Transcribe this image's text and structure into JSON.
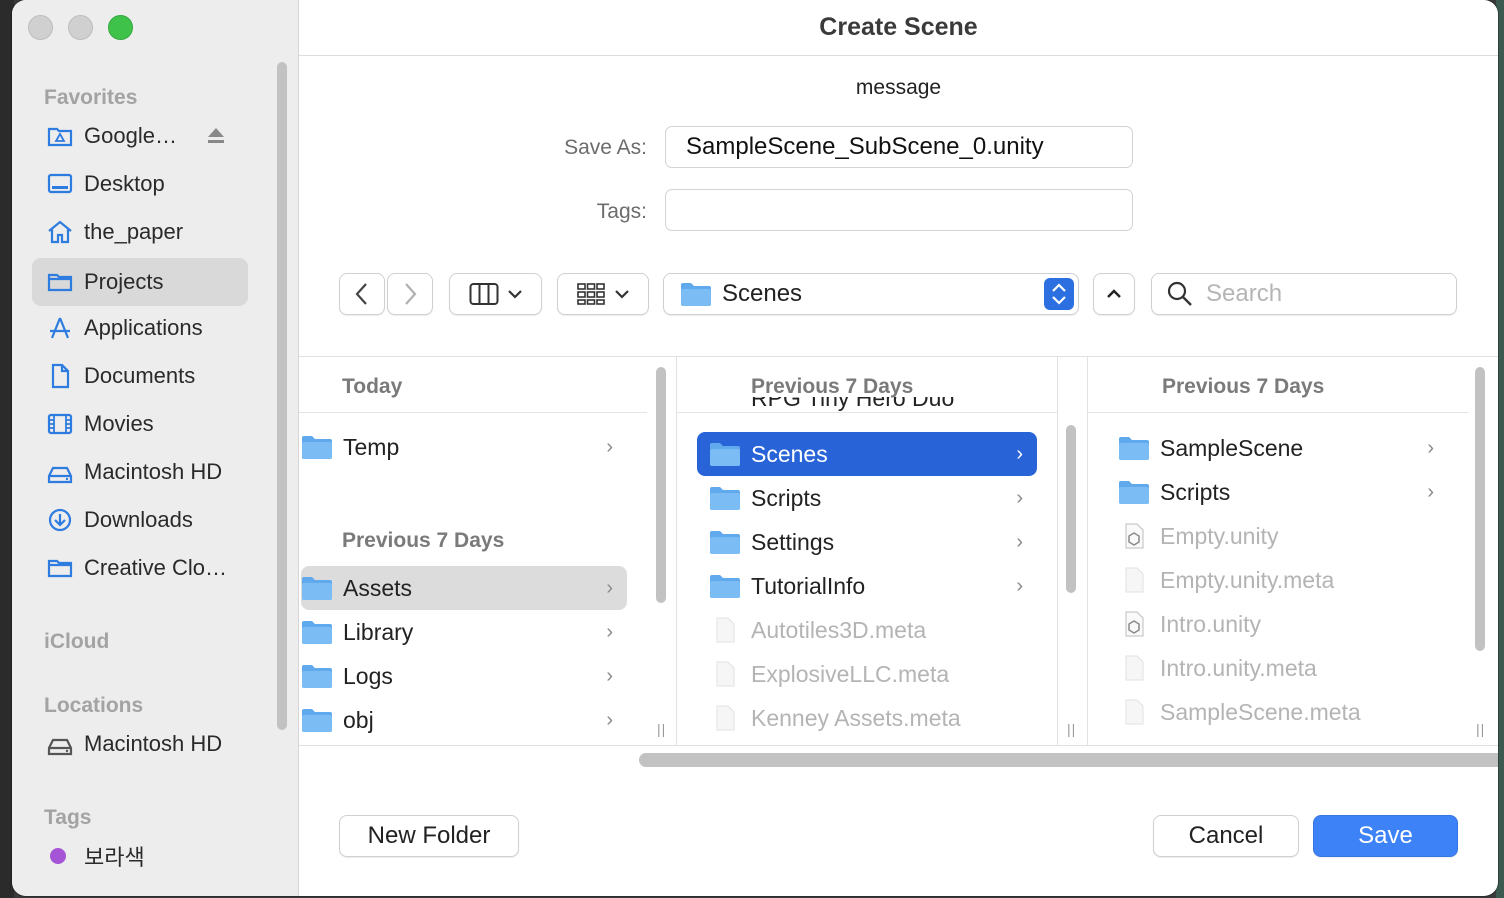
{
  "window": {
    "title": "Create Scene",
    "message": "message"
  },
  "form": {
    "save_as_label": "Save As:",
    "save_as_value": "SampleScene_SubScene_0.unity",
    "tags_label": "Tags:",
    "tags_value": ""
  },
  "toolbar": {
    "location": "Scenes",
    "search_placeholder": "Search"
  },
  "sidebar": {
    "favorites_label": "Favorites",
    "favorites": [
      {
        "label": "Google…",
        "icon": "cloud-drive-icon"
      },
      {
        "label": "Desktop",
        "icon": "desktop-icon"
      },
      {
        "label": "the_paper",
        "icon": "home-icon"
      },
      {
        "label": "Projects",
        "icon": "folder-icon",
        "selected": true
      },
      {
        "label": "Applications",
        "icon": "applications-icon"
      },
      {
        "label": "Documents",
        "icon": "document-icon"
      },
      {
        "label": "Movies",
        "icon": "film-icon"
      },
      {
        "label": "Macintosh HD",
        "icon": "disk-icon"
      },
      {
        "label": "Downloads",
        "icon": "download-icon"
      },
      {
        "label": "Creative Clo…",
        "icon": "folder-icon"
      }
    ],
    "icloud_label": "iCloud",
    "locations_label": "Locations",
    "locations": [
      {
        "label": "Macintosh HD",
        "icon": "disk-icon"
      }
    ],
    "tags_label": "Tags",
    "tags": [
      {
        "label": "보라색",
        "color": "#a554d6"
      }
    ]
  },
  "columns": [
    {
      "header": "Today",
      "today_items": [
        {
          "label": "Temp",
          "type": "folder"
        }
      ],
      "subheader": "Previous 7 Days",
      "items": [
        {
          "label": "Assets",
          "type": "folder",
          "selected": true
        },
        {
          "label": "Library",
          "type": "folder"
        },
        {
          "label": "Logs",
          "type": "folder"
        },
        {
          "label": "obj",
          "type": "folder"
        }
      ]
    },
    {
      "header": "Previous 7 Days",
      "partial_item": "RPG Tiny Hero Duo",
      "items": [
        {
          "label": "Scenes",
          "type": "folder",
          "selected": true
        },
        {
          "label": "Scripts",
          "type": "folder"
        },
        {
          "label": "Settings",
          "type": "folder"
        },
        {
          "label": "TutorialInfo",
          "type": "folder"
        },
        {
          "label": "Autotiles3D.meta",
          "type": "file"
        },
        {
          "label": "ExplosiveLLC.meta",
          "type": "file"
        },
        {
          "label": "Kenney Assets.meta",
          "type": "file"
        }
      ]
    },
    {
      "header": "Previous 7 Days",
      "items": [
        {
          "label": "SampleScene",
          "type": "folder"
        },
        {
          "label": "Scripts",
          "type": "folder"
        },
        {
          "label": "Empty.unity",
          "type": "unity"
        },
        {
          "label": "Empty.unity.meta",
          "type": "file"
        },
        {
          "label": "Intro.unity",
          "type": "unity"
        },
        {
          "label": "Intro.unity.meta",
          "type": "file"
        },
        {
          "label": "SampleScene.meta",
          "type": "file"
        }
      ]
    }
  ],
  "footer": {
    "new_folder": "New Folder",
    "cancel": "Cancel",
    "save": "Save"
  },
  "colors": {
    "accent": "#2963d8",
    "save_button": "#3d82f6",
    "folder": "#5fa9ec"
  }
}
